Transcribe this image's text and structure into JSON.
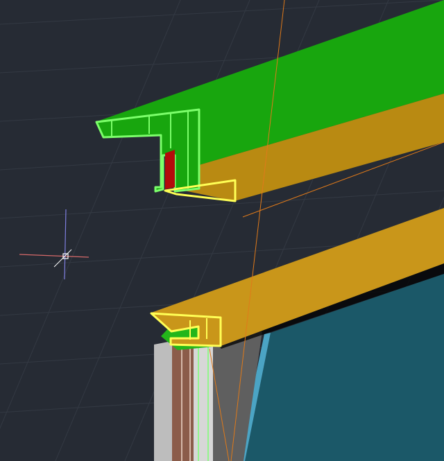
{
  "viewport": {
    "label": "",
    "background_color": "#262b34",
    "grid_color": "#343a44"
  },
  "colors": {
    "upper_beam_top": "#1fa812",
    "upper_beam_front": "#b98a12",
    "lower_beam_top": "#c9961a",
    "lower_beam_front": "#a57811",
    "profile_outline_green": "#7cff6b",
    "profile_outline_yellow": "#ffff55",
    "profile_fill_red": "#b30b0b",
    "glass_panel": "#1d5a68",
    "glass_edge": "#4fa6c8",
    "frame_gray": "#bdbdbd",
    "frame_brown": "#8b5c4a",
    "guide_line_orange": "#e07a1a",
    "cursor_red_axis": "#d76a6a",
    "cursor_blue_axis": "#7f7fe0",
    "cursor_white": "#ffffff"
  },
  "objects": {
    "upper_beam": "upper-beam",
    "lower_beam": "lower-beam",
    "glass_panel": "glass-panel",
    "frame_post": "frame-post",
    "upper_profile": "upper-profile-section",
    "lower_profile": "lower-profile-section",
    "guide_lines": "guide-lines",
    "crosshair": "crosshair-cursor-icon"
  }
}
